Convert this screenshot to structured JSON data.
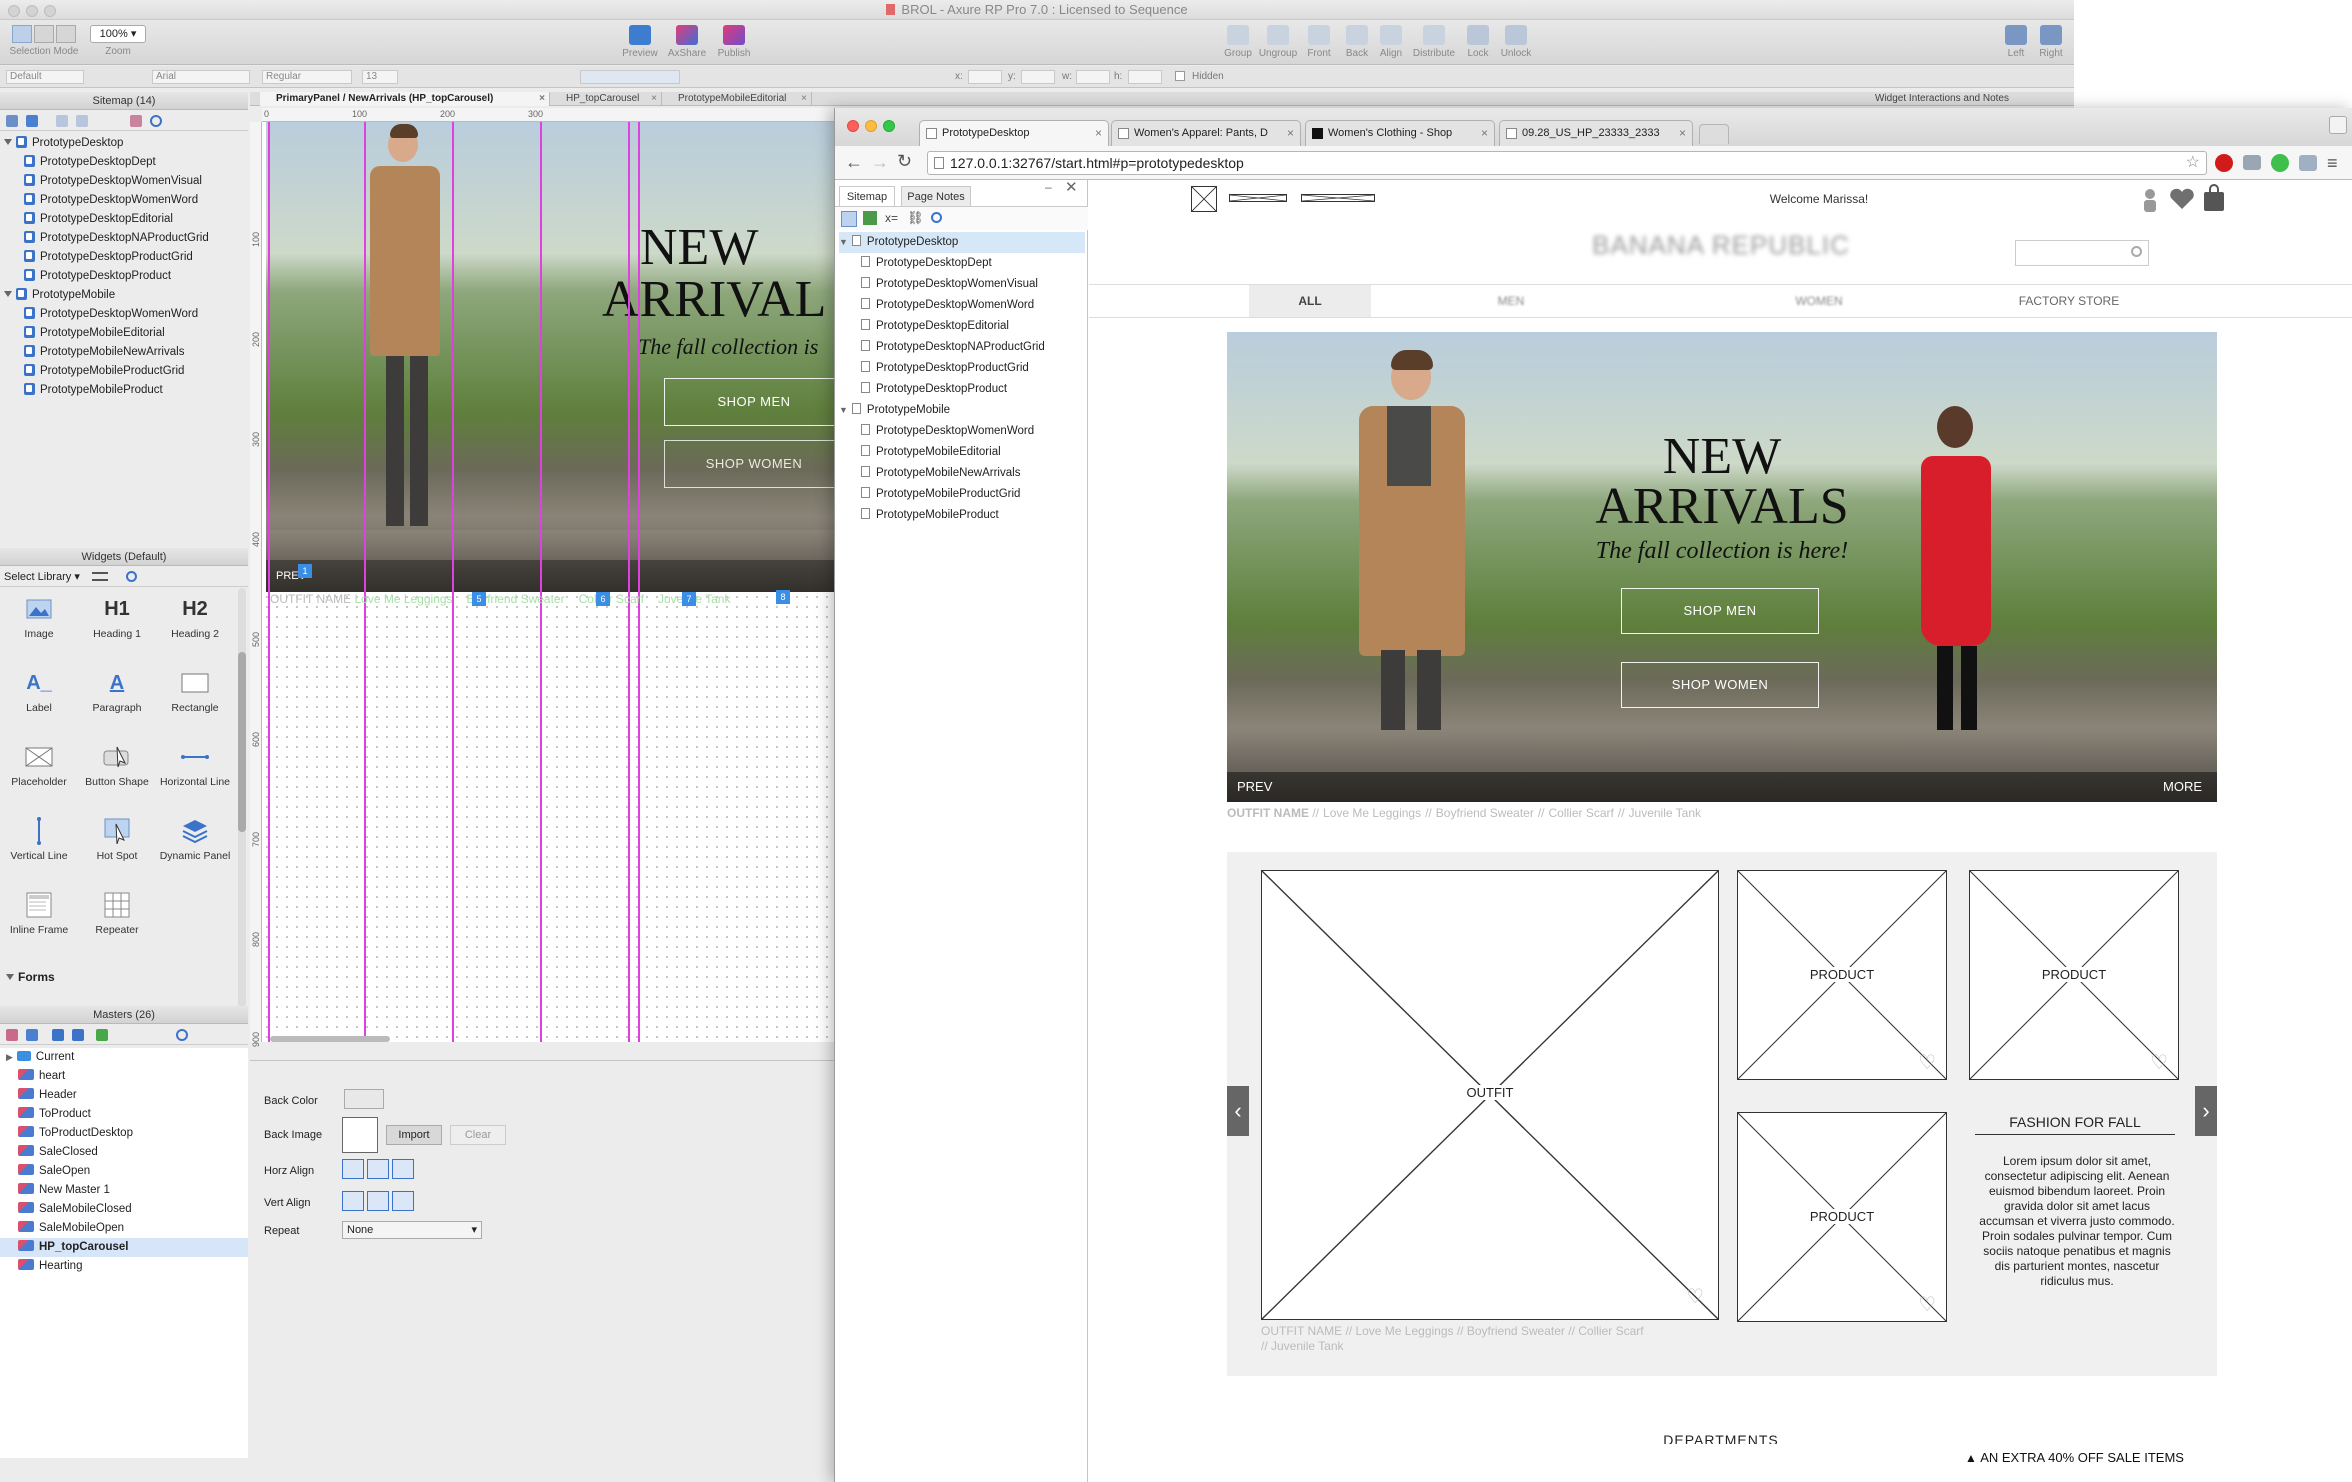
{
  "app": {
    "title": "BROL - Axure RP Pro 7.0 : Licensed to Sequence"
  },
  "toolbar": {
    "selection_mode_label": "Selection Mode",
    "zoom_label": "Zoom",
    "zoom_value": "100%",
    "preview": "Preview",
    "axshare": "AxShare",
    "publish": "Publish",
    "group": "Group",
    "ungroup": "Ungroup",
    "front": "Front",
    "back": "Back",
    "align": "Align",
    "distribute": "Distribute",
    "lock": "Lock",
    "unlock": "Unlock",
    "left": "Left",
    "right": "Right"
  },
  "format": {
    "style": "Default",
    "font": "Arial",
    "weight": "Regular",
    "size": "13",
    "x": "x:",
    "y": "y:",
    "w": "w:",
    "h": "h:",
    "hidden": "Hidden"
  },
  "sitemap_panel": {
    "title": "Sitemap (14)",
    "tree": [
      {
        "label": "PrototypeDesktop",
        "level": 0,
        "folder": true
      },
      {
        "label": "PrototypeDesktopDept",
        "level": 1
      },
      {
        "label": "PrototypeDesktopWomenVisual",
        "level": 1
      },
      {
        "label": "PrototypeDesktopWomenWord",
        "level": 1
      },
      {
        "label": "PrototypeDesktopEditorial",
        "level": 1
      },
      {
        "label": "PrototypeDesktopNAProductGrid",
        "level": 1
      },
      {
        "label": "PrototypeDesktopProductGrid",
        "level": 1
      },
      {
        "label": "PrototypeDesktopProduct",
        "level": 1
      },
      {
        "label": "PrototypeMobile",
        "level": 0,
        "folder": true
      },
      {
        "label": "PrototypeDesktopWomenWord",
        "level": 1
      },
      {
        "label": "PrototypeMobileEditorial",
        "level": 1
      },
      {
        "label": "PrototypeMobileNewArrivals",
        "level": 1
      },
      {
        "label": "PrototypeMobileProductGrid",
        "level": 1
      },
      {
        "label": "PrototypeMobileProduct",
        "level": 1
      }
    ]
  },
  "widgets_panel": {
    "title": "Widgets (Default)",
    "select_library": "Select Library",
    "items": [
      {
        "label": "Image",
        "icon": "image-icon"
      },
      {
        "label": "Heading 1",
        "icon": "h1-icon"
      },
      {
        "label": "Heading 2",
        "icon": "h2-icon"
      },
      {
        "label": "Label",
        "icon": "label-icon"
      },
      {
        "label": "Paragraph",
        "icon": "paragraph-icon"
      },
      {
        "label": "Rectangle",
        "icon": "rectangle-icon"
      },
      {
        "label": "Placeholder",
        "icon": "placeholder-icon"
      },
      {
        "label": "Button Shape",
        "icon": "button-shape-icon"
      },
      {
        "label": "Horizontal Line",
        "icon": "hline-icon"
      },
      {
        "label": "Vertical Line",
        "icon": "vline-icon"
      },
      {
        "label": "Hot Spot",
        "icon": "hotspot-icon"
      },
      {
        "label": "Dynamic Panel",
        "icon": "dynamic-panel-icon"
      },
      {
        "label": "Inline Frame",
        "icon": "inline-frame-icon"
      },
      {
        "label": "Repeater",
        "icon": "repeater-icon"
      }
    ],
    "forms_label": "Forms",
    "h1": "H1",
    "h2": "H2"
  },
  "masters_panel": {
    "title": "Masters (26)",
    "items": [
      {
        "label": "Current",
        "folder": true
      },
      {
        "label": "heart"
      },
      {
        "label": "Header"
      },
      {
        "label": "ToProduct"
      },
      {
        "label": "ToProductDesktop"
      },
      {
        "label": "SaleClosed"
      },
      {
        "label": "SaleOpen"
      },
      {
        "label": "New Master 1"
      },
      {
        "label": "SaleMobileClosed"
      },
      {
        "label": "SaleMobileOpen"
      },
      {
        "label": "HP_topCarousel",
        "selected": true
      },
      {
        "label": "Hearting"
      }
    ]
  },
  "canvas": {
    "tabs": [
      "PrimaryPanel / NewArrivals (HP_topCarousel)",
      "HP_topCarousel",
      "PrototypeMobileEditorial"
    ],
    "ruler_h": [
      "0",
      "100",
      "200",
      "300"
    ],
    "ruler_v": [
      "100",
      "200",
      "300",
      "400",
      "500",
      "600",
      "700",
      "800",
      "900"
    ],
    "hero_title_1": "NEW",
    "hero_title_2": "ARRIVAL",
    "hero_sub": "The fall collection is",
    "shop_men": "SHOP MEN",
    "shop_women": "SHOP WOMEN",
    "prev": "PREV",
    "caption_name": "OUTFIT NAME",
    "caption_items": [
      "Love Me Leggings",
      "Boyfriend Sweater",
      "Collier Scarf",
      "Juvenile Tank"
    ],
    "markers": [
      "1",
      "5",
      "6",
      "7",
      "8"
    ]
  },
  "style_panel": {
    "back_color": "Back Color",
    "back_image": "Back Image",
    "import": "Import",
    "clear": "Clear",
    "horz_align": "Horz Align",
    "vert_align": "Vert Align",
    "repeat": "Repeat",
    "repeat_value": "None"
  },
  "right_panel_title": "Widget Interactions and Notes",
  "browser": {
    "tabs": [
      "PrototypeDesktop",
      "Women's Apparel: Pants, D",
      "Women's Clothing - Shop",
      "09.28_US_HP_23333_2333"
    ],
    "url": "127.0.0.1:32767/start.html#p=prototypedesktop",
    "sidebar_tabs": [
      "Sitemap",
      "Page Notes"
    ],
    "sidebar_tree": [
      {
        "label": "PrototypeDesktop",
        "level": 0,
        "selected": true
      },
      {
        "label": "PrototypeDesktopDept",
        "level": 1
      },
      {
        "label": "PrototypeDesktopWomenVisual",
        "level": 1
      },
      {
        "label": "PrototypeDesktopWomenWord",
        "level": 1
      },
      {
        "label": "PrototypeDesktopEditorial",
        "level": 1
      },
      {
        "label": "PrototypeDesktopNAProductGrid",
        "level": 1
      },
      {
        "label": "PrototypeDesktopProductGrid",
        "level": 1
      },
      {
        "label": "PrototypeDesktopProduct",
        "level": 1
      },
      {
        "label": "PrototypeMobile",
        "level": 0
      },
      {
        "label": "PrototypeDesktopWomenWord",
        "level": 1
      },
      {
        "label": "PrototypeMobileEditorial",
        "level": 1
      },
      {
        "label": "PrototypeMobileNewArrivals",
        "level": 1
      },
      {
        "label": "PrototypeMobileProductGrid",
        "level": 1
      },
      {
        "label": "PrototypeMobileProduct",
        "level": 1
      }
    ]
  },
  "site": {
    "welcome": "Welcome Marissa!",
    "logo": "BANANA REPUBLIC",
    "nav": [
      "ALL",
      "MEN",
      "WOMEN",
      "FACTORY STORE"
    ],
    "hero": {
      "title_1": "NEW",
      "title_2": "ARRIVALS",
      "subtitle": "The fall collection is here!",
      "shop_men": "SHOP MEN",
      "shop_women": "SHOP WOMEN",
      "prev": "PREV",
      "more": "MORE"
    },
    "caption": {
      "name": "OUTFIT NAME",
      "sep": "//",
      "items": [
        "Love Me Leggings",
        "Boyfriend Sweater",
        "Collier Scarf",
        "Juvenile Tank"
      ]
    },
    "grid": {
      "outfit": "OUTFIT",
      "product": "PRODUCT",
      "fashion_title": "FASHION FOR FALL",
      "fashion_body": "Lorem ipsum dolor sit amet, consectetur adipiscing elit. Aenean euismod bibendum laoreet. Proin gravida dolor sit amet lacus accumsan et viverra justo commodo. Proin sodales pulvinar tempor. Cum sociis natoque penatibus et magnis dis parturient montes, nascetur ridiculus mus.",
      "caption_line1": "OUTFIT NAME // Love Me Leggings // Boyfriend Sweater // Collier Scarf",
      "caption_line2": "// Juvenile Tank"
    },
    "departments": "DEPARTMENTS",
    "promo": "AN EXTRA 40% OFF SALE ITEMS"
  },
  "colors": {
    "guide": "#e040e0",
    "marker": "#3a8ee6",
    "red_dress": "#d81e2a",
    "coat": "#b5855a"
  }
}
